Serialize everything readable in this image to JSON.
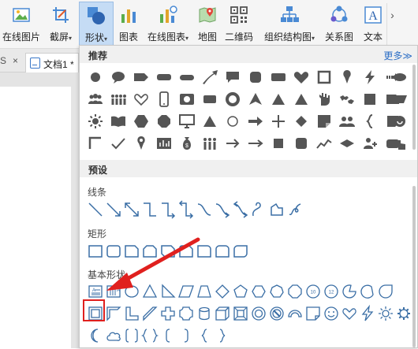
{
  "ribbon": {
    "items": [
      {
        "label": "在线图片",
        "icon": "online-picture-icon"
      },
      {
        "label": "截屏",
        "icon": "screenshot-icon",
        "caret": "▾"
      },
      {
        "label": "形状",
        "icon": "shapes-icon",
        "caret": "▾",
        "active": true
      },
      {
        "label": "图表",
        "icon": "chart-icon"
      },
      {
        "label": "在线图表",
        "icon": "online-chart-icon",
        "caret": "▾"
      },
      {
        "label": "地图",
        "icon": "map-icon"
      },
      {
        "label": "二维码",
        "icon": "qrcode-icon"
      },
      {
        "label": "组织结构图",
        "icon": "org-chart-icon",
        "caret": "▾"
      },
      {
        "label": "关系图",
        "icon": "relationship-icon"
      },
      {
        "label": "文本",
        "icon": "textbox-icon"
      }
    ],
    "scroll_glyph": "›"
  },
  "document": {
    "tab_close": "×",
    "tab_fragment": "S",
    "tab_title": "文档1 *"
  },
  "panel": {
    "recommended_title": "推荐",
    "more_label": "更多≫",
    "preset_title": "预设",
    "lines_title": "线条",
    "rect_title": "矩形",
    "basic_title": "基本形状"
  },
  "colors": {
    "accent": "#2d6fc6",
    "shape_outline": "#3a6ea5",
    "highlight": "#e0201e",
    "dark_icon": "#555555"
  }
}
